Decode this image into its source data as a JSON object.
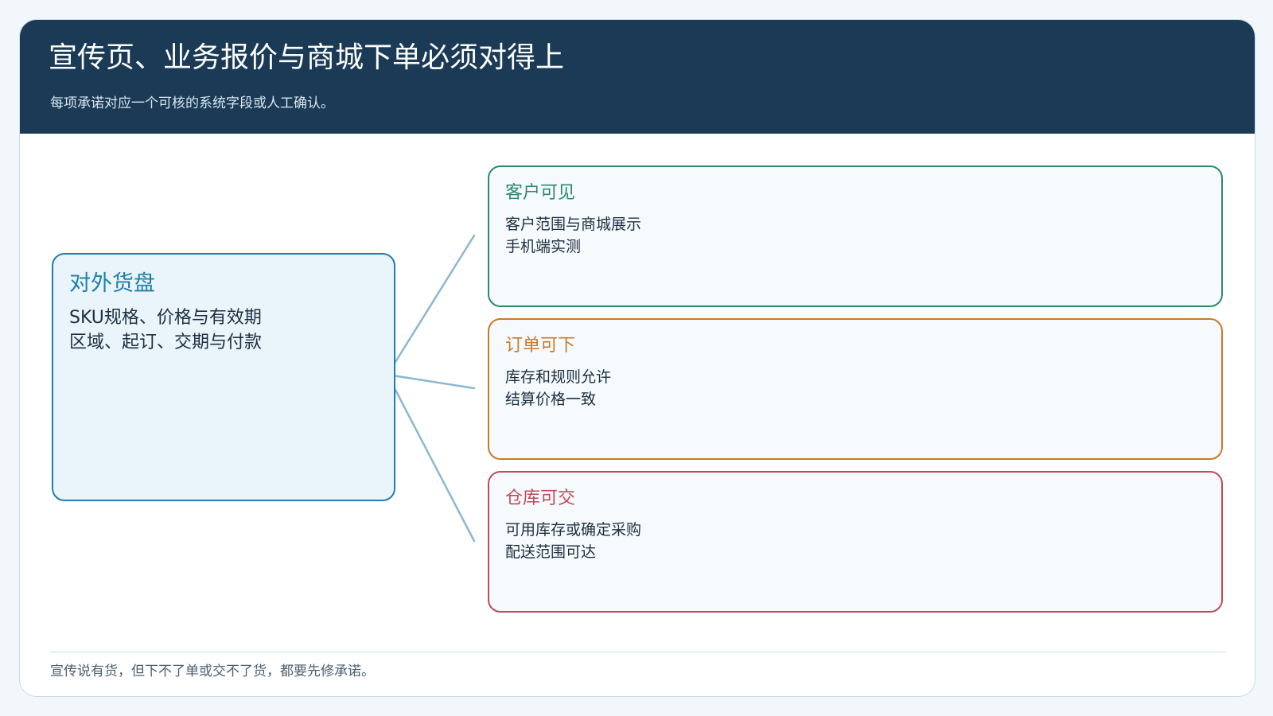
{
  "header": {
    "title": "宣传页、业务报价与商城下单必须对得上",
    "subtitle": "每项承诺对应一个可核的系统字段或人工确认。"
  },
  "source": {
    "title": "对外货盘",
    "lines": [
      "SKU规格、价格与有效期",
      "区域、起订、交期与付款"
    ],
    "color": "#1e7fae"
  },
  "targets": [
    {
      "title": "客户可见",
      "lines": [
        "客户范围与商城展示",
        "手机端实测"
      ],
      "color": "#2a8a6a"
    },
    {
      "title": "订单可下",
      "lines": [
        "库存和规则允许",
        "结算价格一致"
      ],
      "color": "#c87a2a"
    },
    {
      "title": "仓库可交",
      "lines": [
        "可用库存或确定采购",
        "配送范围可达"
      ],
      "color": "#c04b5a"
    }
  ],
  "connector_color": "#8bb8cf",
  "footer": {
    "note": "宣传说有货，但下不了单或交不了货，都要先修承诺。"
  }
}
